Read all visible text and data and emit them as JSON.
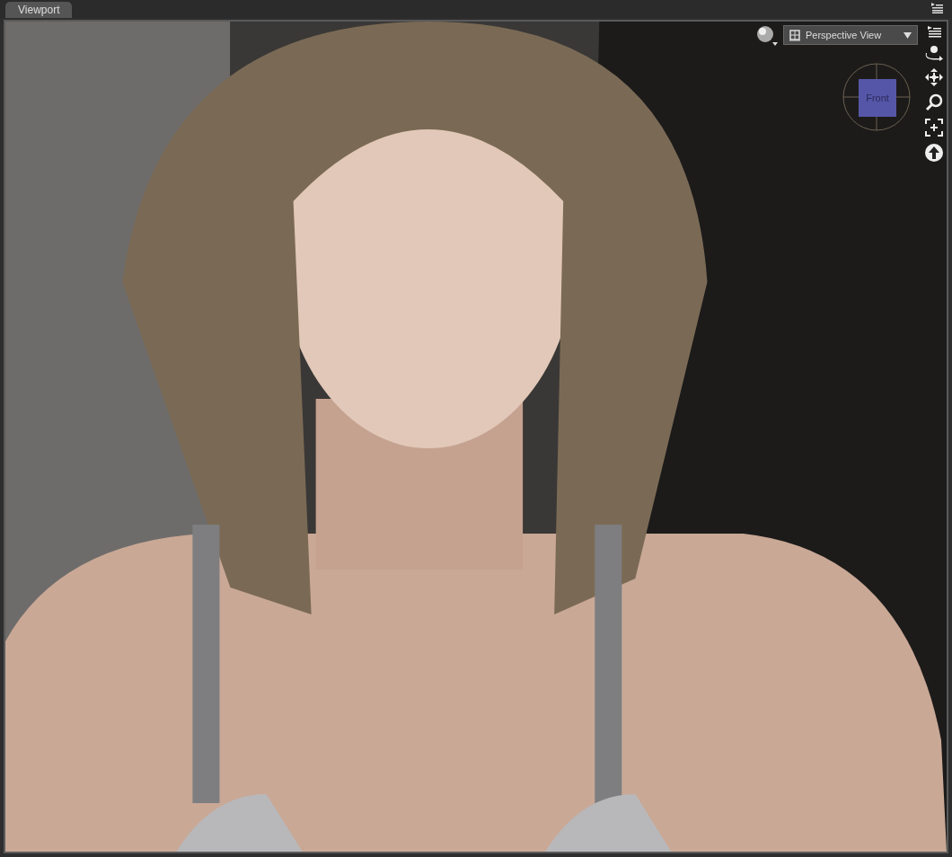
{
  "tabs": [
    {
      "label": "Viewport",
      "selected": true
    }
  ],
  "view_menu": {
    "label": "Perspective View"
  },
  "view_cube": {
    "label": "Front"
  }
}
